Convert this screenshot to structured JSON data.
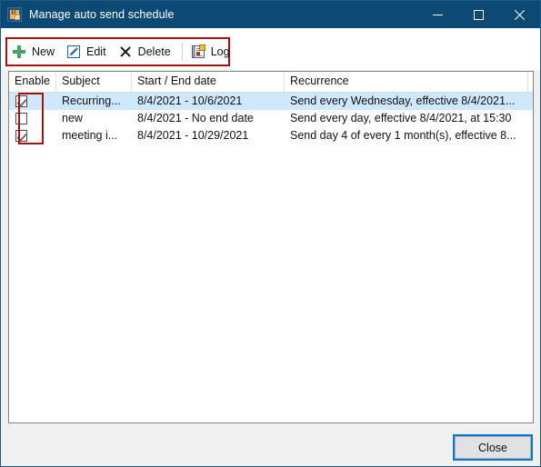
{
  "window": {
    "title": "Manage auto send schedule",
    "icon": "app-icon",
    "controls": {
      "minimize": "minimize-icon",
      "maximize": "maximize-icon",
      "close": "close-icon"
    }
  },
  "toolbar": {
    "buttons": [
      {
        "label": "New",
        "icon": "plus-icon"
      },
      {
        "label": "Edit",
        "icon": "pencil-icon"
      },
      {
        "label": "Delete",
        "icon": "x-icon"
      },
      {
        "label": "Log",
        "icon": "log-icon"
      }
    ]
  },
  "list": {
    "columns": [
      "Enable",
      "Subject",
      "Start / End date",
      "Recurrence"
    ],
    "rows": [
      {
        "enabled": true,
        "subject": "Recurring...",
        "dates": "8/4/2021 - 10/6/2021",
        "recurrence": "Send every Wednesday, effective 8/4/2021...",
        "selected": true
      },
      {
        "enabled": false,
        "subject": "new",
        "dates": "8/4/2021 - No end date",
        "recurrence": "Send every day, effective 8/4/2021, at 15:30",
        "selected": false
      },
      {
        "enabled": true,
        "subject": "meeting i...",
        "dates": "8/4/2021 - 10/29/2021",
        "recurrence": "Send day 4 of every 1 month(s), effective 8...",
        "selected": false
      }
    ]
  },
  "footer": {
    "close_label": "Close"
  },
  "annotations": {
    "toolbar_highlight_color": "#a51111",
    "checkbox_highlight_color": "#a51111"
  },
  "colors": {
    "titlebar": "#0c4a75",
    "selection": "#cfe8fb",
    "dialog_background": "#f0f0f0",
    "focus_outline": "#0078d7"
  }
}
